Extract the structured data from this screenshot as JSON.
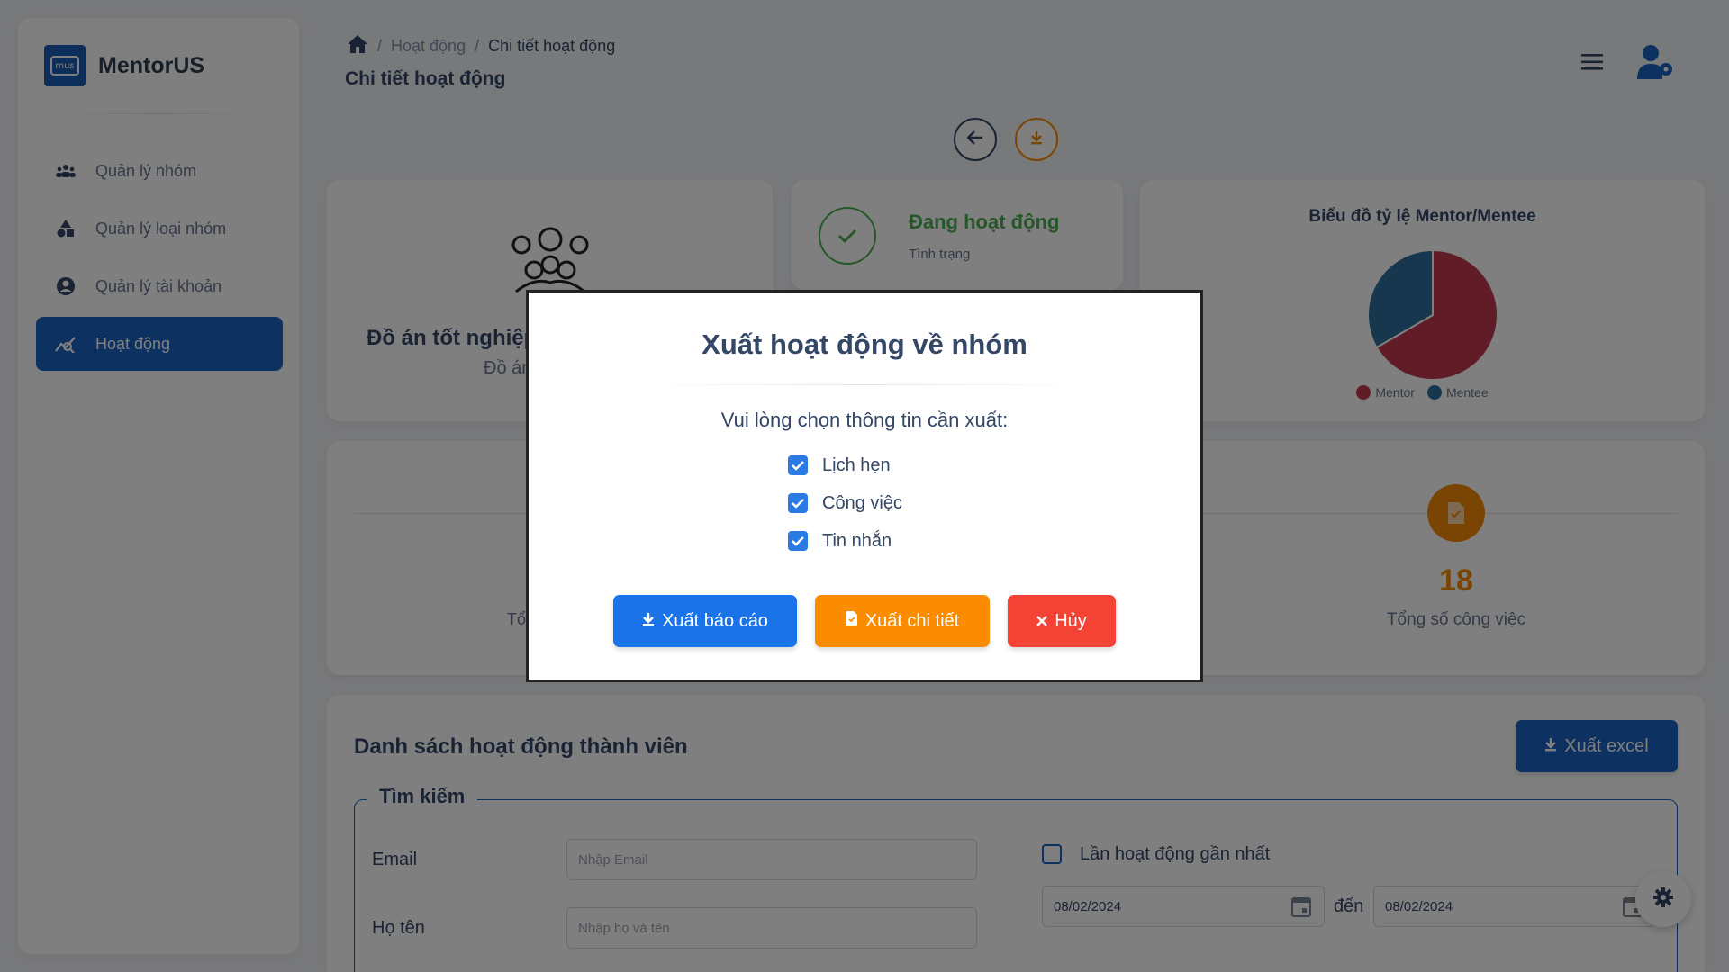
{
  "app": {
    "name": "MentorUS",
    "logo_text": "mus"
  },
  "sidebar": {
    "items": [
      {
        "label": "Quản lý nhóm",
        "icon": "groups-icon"
      },
      {
        "label": "Quản lý loại nhóm",
        "icon": "category-icon"
      },
      {
        "label": "Quản lý tài khoản",
        "icon": "account-circle-icon"
      },
      {
        "label": "Hoạt động",
        "icon": "analytics-icon"
      }
    ]
  },
  "breadcrumb": {
    "parent": "Hoạt động",
    "current": "Chi tiết hoạt động"
  },
  "page_title": "Chi tiết hoạt động",
  "group_card": {
    "title": "Đồ án tốt nghiệp",
    "subtitle": "Đồ án"
  },
  "status_card": {
    "value": "Đang hoạt động",
    "label": "Tình trạng"
  },
  "chart_card": {
    "title": "Biểu đồ tỷ lệ Mentor/Mentee",
    "chart_data": {
      "type": "pie",
      "title": "Biểu đồ tỷ lệ Mentor/Mentee",
      "categories": [
        "Mentor",
        "Mentee"
      ],
      "values": [
        2,
        1
      ],
      "colors": [
        "#c0394f",
        "#2e6f9e"
      ],
      "legend": "bottom"
    }
  },
  "stats": {
    "left_label": "Tổ",
    "tasks_value": "18",
    "tasks_label": "Tổng số công việc"
  },
  "members": {
    "title": "Danh sách hoạt động thành viên",
    "export_label": "Xuất excel",
    "search_legend": "Tìm kiếm",
    "email_label": "Email",
    "email_placeholder": "Nhập Email",
    "name_label": "Họ tên",
    "name_placeholder": "Nhập họ và tên",
    "last_active_label": "Lần hoạt động gần nhất",
    "date_from": "08/02/2024",
    "date_to_label": "đến",
    "date_to": "08/02/2024"
  },
  "modal": {
    "title": "Xuất hoạt động về nhóm",
    "subtitle": "Vui lòng chọn thông tin cần xuất:",
    "options": [
      {
        "label": "Lịch hẹn",
        "checked": true
      },
      {
        "label": "Công việc",
        "checked": true
      },
      {
        "label": "Tin nhắn",
        "checked": true
      }
    ],
    "export_report": "Xuất báo cáo",
    "export_detail": "Xuất chi tiết",
    "cancel": "Hủy"
  },
  "colors": {
    "primary": "#1a63c2",
    "orange": "#f58a07",
    "red": "#f44335",
    "blue": "#1a73e8",
    "green": "#4caf50"
  }
}
